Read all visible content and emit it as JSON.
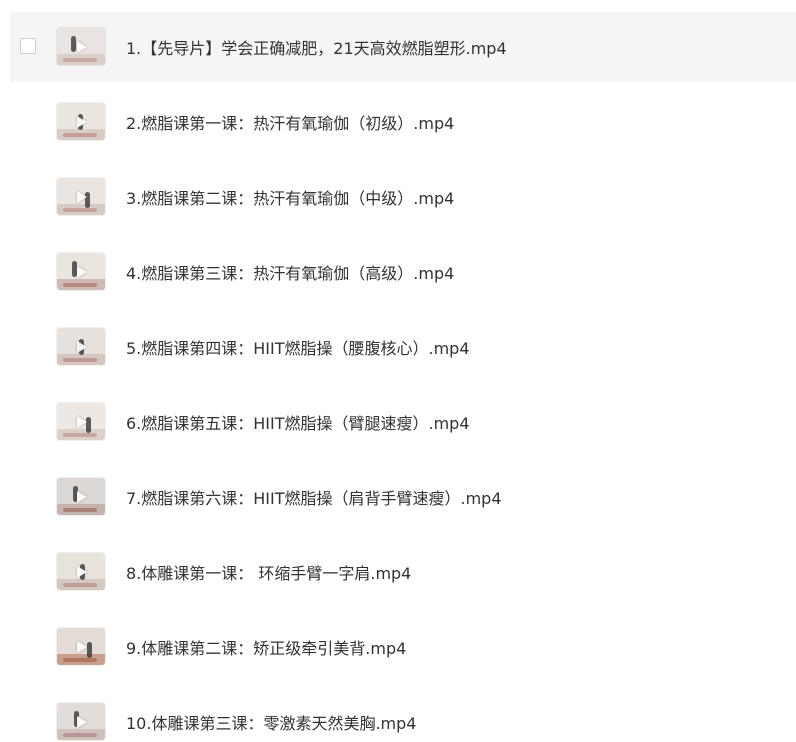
{
  "file_list": {
    "hovered_index": 0,
    "items": [
      {
        "name": "1.【先导片】学会正确减肥，21天高效燃脂塑形.mp4",
        "thumb_bg": "#e9e4e2",
        "thumb_floor": "#d9cfcb",
        "thumb_accent": "#c9a9a4"
      },
      {
        "name": "2.燃脂课第一课：热汗有氧瑜伽（初级）.mp4",
        "thumb_bg": "#ece6e1",
        "thumb_floor": "#d8ccc4",
        "thumb_accent": "#c79f98"
      },
      {
        "name": "3.燃脂课第二课：热汗有氧瑜伽（中级）.mp4",
        "thumb_bg": "#eae5e1",
        "thumb_floor": "#d6cbc5",
        "thumb_accent": "#c6a19b"
      },
      {
        "name": "4.燃脂课第三课：热汗有氧瑜伽（高级）.mp4",
        "thumb_bg": "#ebe5e0",
        "thumb_floor": "#cdbab3",
        "thumb_accent": "#b98580"
      },
      {
        "name": "5.燃脂课第四课：HIIT燃脂操（腰腹核心）.mp4",
        "thumb_bg": "#e6e1dc",
        "thumb_floor": "#d3c7c0",
        "thumb_accent": "#bf9a94"
      },
      {
        "name": "6.燃脂课第五课：HIIT燃脂操（臂腿速瘦）.mp4",
        "thumb_bg": "#ede8e3",
        "thumb_floor": "#dbd0ca",
        "thumb_accent": "#c8a6a0"
      },
      {
        "name": "7.燃脂课第六课：HIIT燃脂操（肩背手臂速瘦）.mp4",
        "thumb_bg": "#dcd8d6",
        "thumb_floor": "#c4b3ae",
        "thumb_accent": "#a98079"
      },
      {
        "name": "8.体雕课第一课： 环缩手臂一字肩.mp4",
        "thumb_bg": "#e8e2dc",
        "thumb_floor": "#d4c8c0",
        "thumb_accent": "#c09d96"
      },
      {
        "name": "9.体雕课第二课：矫正级牵引美背.mp4",
        "thumb_bg": "#e4ddd7",
        "thumb_floor": "#c9a08e",
        "thumb_accent": "#b0775f"
      },
      {
        "name": "10.体雕课第三课：零激素天然美胸.mp4",
        "thumb_bg": "#e3ddd9",
        "thumb_floor": "#cfc1bb",
        "thumb_accent": "#b89892"
      }
    ]
  }
}
